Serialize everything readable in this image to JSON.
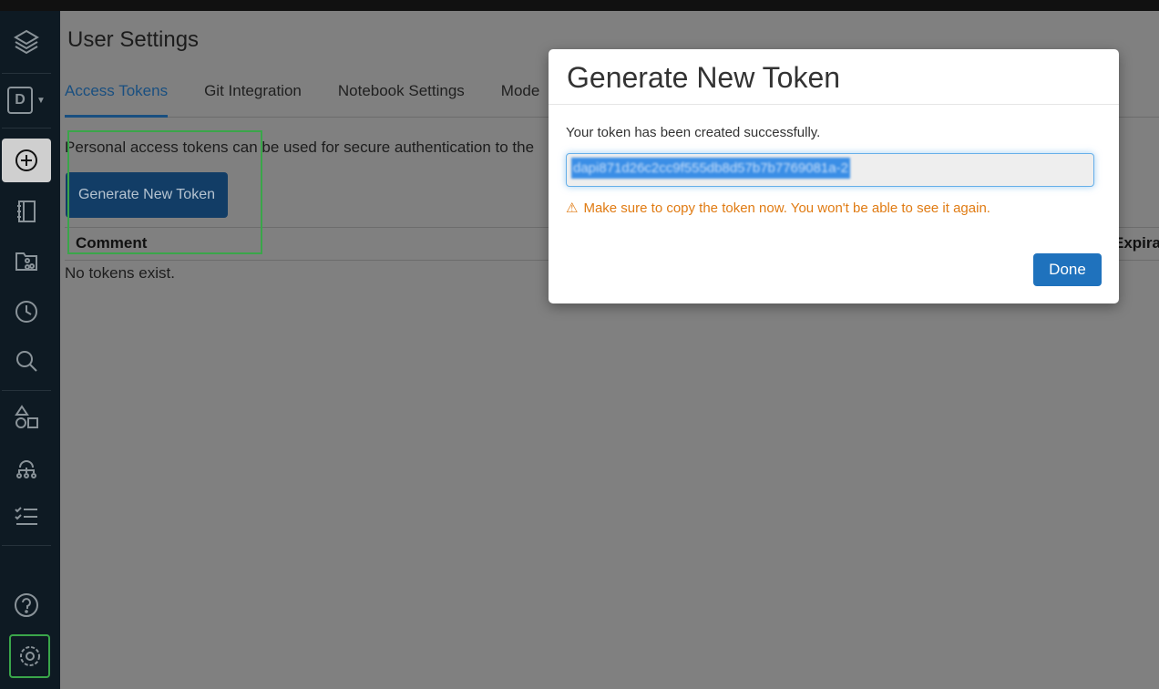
{
  "page": {
    "title": "User Settings"
  },
  "sidebar": {
    "workspace_initial": "D",
    "items": [
      {
        "icon": "layers-icon"
      },
      {
        "icon": "workspace-switcher"
      },
      {
        "icon": "create-plus-icon"
      },
      {
        "icon": "notebook-icon"
      },
      {
        "icon": "repos-folder-icon"
      },
      {
        "icon": "recent-clock-icon"
      },
      {
        "icon": "search-icon"
      },
      {
        "icon": "shapes-icon"
      },
      {
        "icon": "cluster-network-icon"
      },
      {
        "icon": "jobs-checklist-icon"
      },
      {
        "icon": "help-icon"
      },
      {
        "icon": "settings-gear-icon"
      }
    ]
  },
  "tabs": [
    {
      "label": "Access Tokens",
      "active": true
    },
    {
      "label": "Git Integration"
    },
    {
      "label": "Notebook Settings"
    },
    {
      "label": "Mode"
    }
  ],
  "content": {
    "description": "Personal access tokens can be used for secure authentication to the",
    "generate_button": "Generate New Token",
    "table_headers": [
      "Comment",
      "Expira"
    ],
    "empty_text": "No tokens exist."
  },
  "modal": {
    "title": "Generate New Token",
    "message": "Your token has been created successfully.",
    "token": "dapi871d26c2cc9f555db8d57b7b7769081a-2",
    "warning": "Make sure to copy the token now. You won't be able to see it again.",
    "done_button": "Done",
    "warning_color": "#e07b13",
    "accent_color": "#1f72bd"
  }
}
